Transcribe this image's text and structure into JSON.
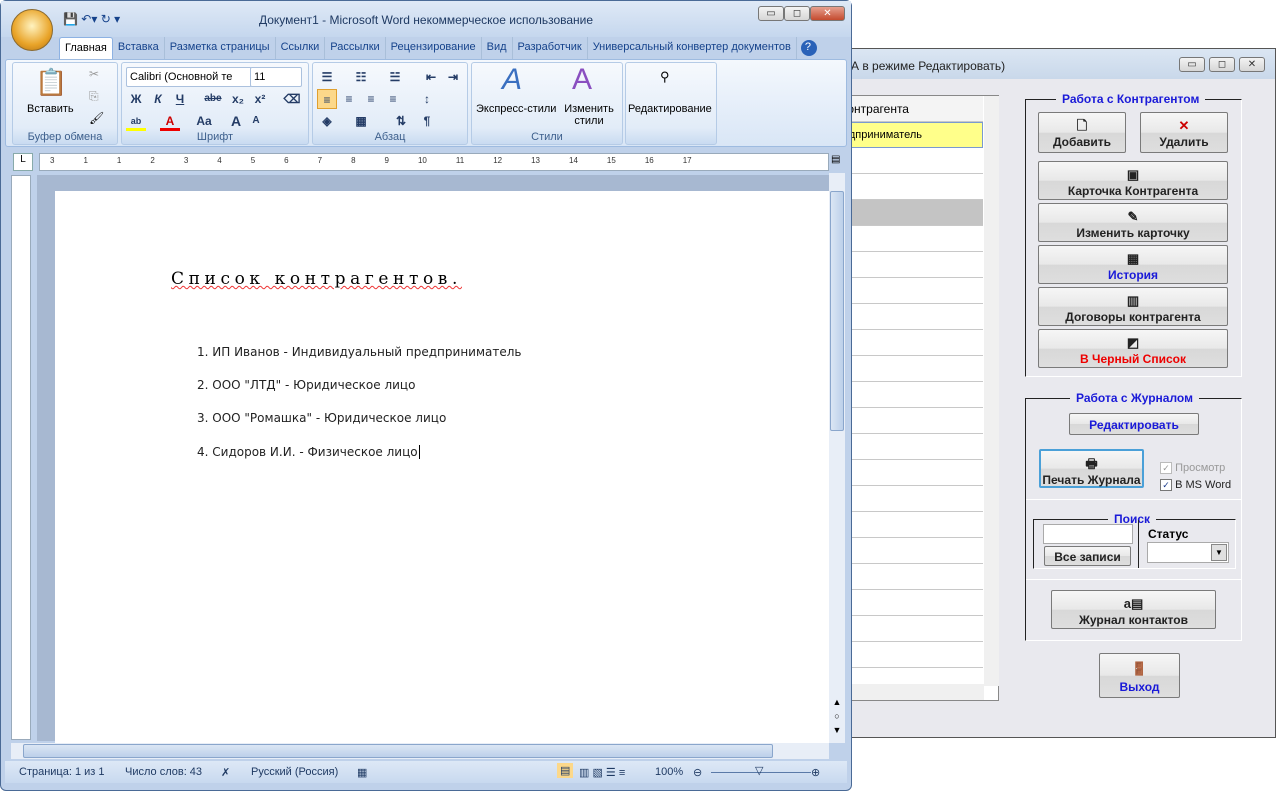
{
  "app": {
    "title": "А в режиме Редактировать)",
    "grid": {
      "header": "контрагента",
      "rows": [
        "едприниматель"
      ]
    },
    "contractor_group": {
      "title": "Работа с Контрагентом",
      "add": "Добавить",
      "delete": "Удалить",
      "card": "Карточка Контрагента",
      "edit_card": "Изменить карточку",
      "history": "История",
      "contracts": "Договоры контрагента",
      "blacklist": "В Черный Список"
    },
    "journal_group": {
      "title": "Работа с Журналом",
      "edit": "Редактировать",
      "print": "Печать Журнала",
      "preview": "Просмотр",
      "preview_checked": true,
      "ms_word": "B MS Word",
      "ms_word_checked": true
    },
    "search": {
      "title": "Поиск",
      "input_value": "",
      "all_records": "Все записи",
      "status_label": "Статус",
      "status_value": ""
    },
    "contacts_log": "Журнал контактов",
    "exit": "Выход"
  },
  "word": {
    "title": "Документ1 - Microsoft Word некоммерческое использование",
    "tabs": [
      "Главная",
      "Вставка",
      "Разметка страницы",
      "Ссылки",
      "Рассылки",
      "Рецензирование",
      "Вид",
      "Разработчик",
      "Универсальный конвертер документов"
    ],
    "ribbon": {
      "paste": "Вставить",
      "clipboard": "Буфер обмена",
      "font_name": "Calibri (Основной те",
      "font_size": "11",
      "font": "Шрифт",
      "paragraph": "Абзац",
      "quick_styles": "Экспресс-стили",
      "change_styles": "Изменить стили",
      "styles": "Стили",
      "editing": "Редактирование",
      "bold": "Ж",
      "italic": "К",
      "underline": "Ч",
      "strike": "abe",
      "sub": "x₂",
      "sup": "x²",
      "case": "Aa",
      "grow": "A",
      "shrink": "A"
    },
    "document": {
      "heading": "Список контрагентов.",
      "items": [
        "1. ИП Иванов - Индивидуальный предприниматель",
        "2. ООО \"ЛТД\" - Юридическое лицо",
        "3. ООО \"Ромашка\" - Юридическое лицо",
        "4. Сидоров И.И. - Физическое лицо"
      ]
    },
    "status": {
      "page": "Страница: 1 из 1",
      "words": "Число слов: 43",
      "language": "Русский (Россия)",
      "zoom": "100%"
    },
    "ruler_ticks": [
      "3",
      "1",
      "1",
      "2",
      "3",
      "4",
      "5",
      "6",
      "7",
      "8",
      "9",
      "10",
      "11",
      "12",
      "13",
      "14",
      "15",
      "16",
      "17"
    ]
  }
}
